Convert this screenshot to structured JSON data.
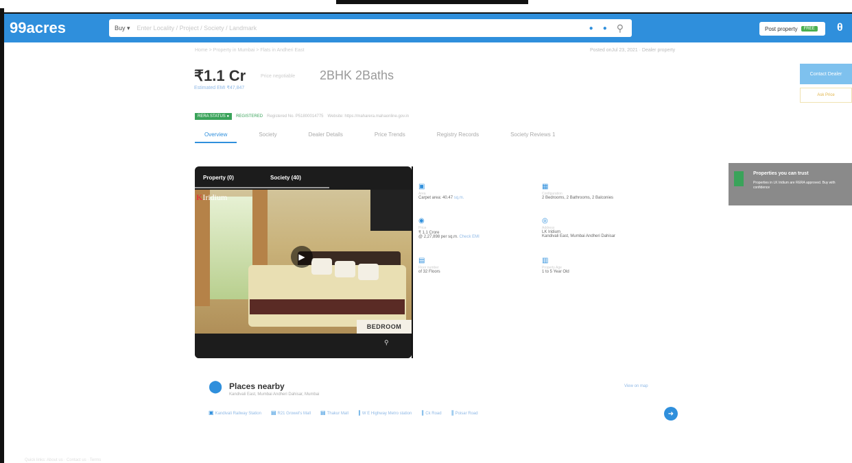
{
  "header": {
    "logo": "99acres",
    "search_type": "Buy",
    "search_placeholder": "Enter Locality / Project / Society / Landmark",
    "post_label": "Post property",
    "post_badge": "FREE"
  },
  "listing": {
    "price": "₹1.1 Cr",
    "price_sub": "Estimated EMI ₹47,847",
    "emi_note": "Price negotiable",
    "config": "2BHK 2Baths",
    "posted": "Posted onJul 23, 2021 · Dealer property",
    "breadcrumb": "Home > Property in Mumbai > Flats in Andheri East"
  },
  "badges": {
    "rera": "RERA STATUS",
    "registered": "REGISTERED",
    "reg_no": "Registered No. P51800014775",
    "note": "Website: https://maharera.mahaonline.gov.in"
  },
  "tabs": [
    {
      "label": "Overview"
    },
    {
      "label": "Society"
    },
    {
      "label": "Dealer Details"
    },
    {
      "label": "Price Trends"
    },
    {
      "label": "Registry Records"
    },
    {
      "label": "Society Reviews"
    }
  ],
  "tabs_extra": "1",
  "actions": {
    "contact": "Contact Dealer",
    "ask": "Ask Price"
  },
  "media": {
    "tab_property": "Property (0)",
    "tab_society": "Society (40)",
    "caption": "BEDROOM",
    "brand_k": "K",
    "brand": "Iridium"
  },
  "details": [
    {
      "label": "Area",
      "value": "Carpet area: 40.47",
      "link": "sq.m."
    },
    {
      "label": "Configuration",
      "value": "2 Bedrooms, 2 Bathrooms, 2 Balconies"
    },
    {
      "label": "Price",
      "value": "₹ 1.1 Crore",
      "value2": "@ 2,27,898 per sq.m.",
      "link": "Check EMI"
    },
    {
      "label": "Address",
      "value": "LK Iridium",
      "value2": "Kandivali East, Mumbai Andheri Dahisar"
    },
    {
      "label": "Floor number",
      "value": "of 32 Floors"
    },
    {
      "label": "Property Age",
      "value": "1 to 5 Year Old"
    }
  ],
  "promo": {
    "title": "Properties you can trust",
    "sub": "Properties in LK Iridium are RERA approved. Buy with confidence"
  },
  "nearby": {
    "title": "Places nearby",
    "sub": "Kandivali East, Mumbai Andheri Dahisar, Mumbai",
    "view_all": "View on map",
    "chips": [
      {
        "label": "Kandivali Railway Station",
        "icon": "train-icon"
      },
      {
        "label": "R21 Growel's Mall",
        "icon": "mall-icon"
      },
      {
        "label": "Thakur Mall",
        "icon": "mall-icon"
      },
      {
        "label": "W E Highway Metro station",
        "icon": "metro-icon"
      },
      {
        "label": "Ck Road",
        "icon": "road-icon"
      },
      {
        "label": "Poisar Road",
        "icon": "road-icon"
      }
    ]
  },
  "footer": "Quick links: About us · Contact us · Terms",
  "colors": {
    "brand": "#2f8fdc",
    "green": "#3aa35a"
  }
}
